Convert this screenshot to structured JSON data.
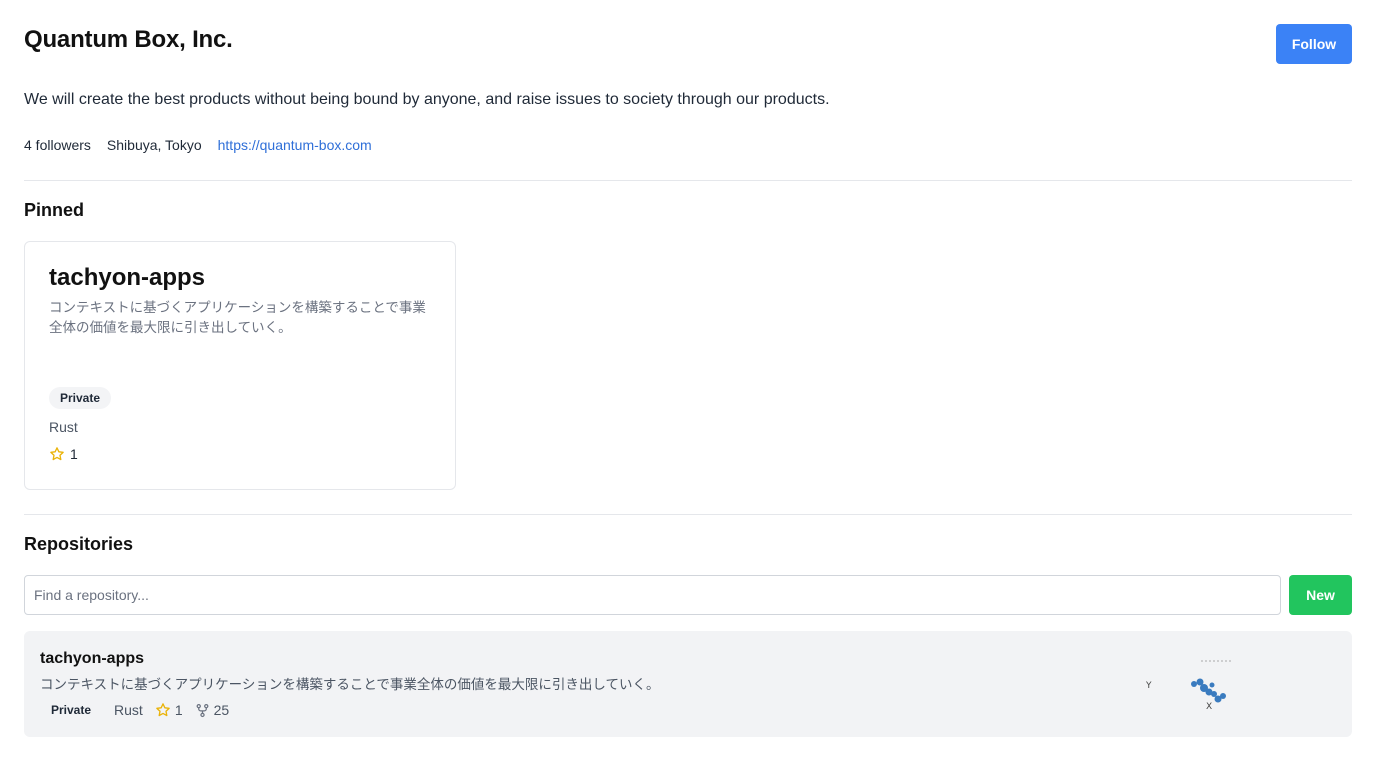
{
  "org": {
    "name": "Quantum Box, Inc.",
    "description": "We will create the best products without being bound by anyone, and raise issues to society through our products.",
    "followers": "4 followers",
    "location": "Shibuya, Tokyo",
    "website": "https://quantum-box.com",
    "follow_label": "Follow"
  },
  "pinned": {
    "title": "Pinned",
    "card": {
      "name": "tachyon-apps",
      "description": "コンテキストに基づくアプリケーションを構築することで事業全体の価値を最大限に引き出していく。",
      "visibility": "Private",
      "language": "Rust",
      "stars": "1"
    }
  },
  "repositories": {
    "title": "Repositories",
    "search_placeholder": "Find a repository...",
    "new_label": "New",
    "items": [
      {
        "name": "tachyon-apps",
        "description": "コンテキストに基づくアプリケーションを構築することで事業全体の価値を最大限に引き出していく。",
        "visibility": "Private",
        "language": "Rust",
        "stars": "1",
        "forks": "25"
      }
    ]
  },
  "colors": {
    "follow_button": "#3b82f6",
    "new_button": "#22c55e",
    "link": "#2f6fd8",
    "star": "#eab308",
    "chart": "#3a7bbf"
  },
  "icons": [
    "star-icon",
    "fork-icon"
  ]
}
